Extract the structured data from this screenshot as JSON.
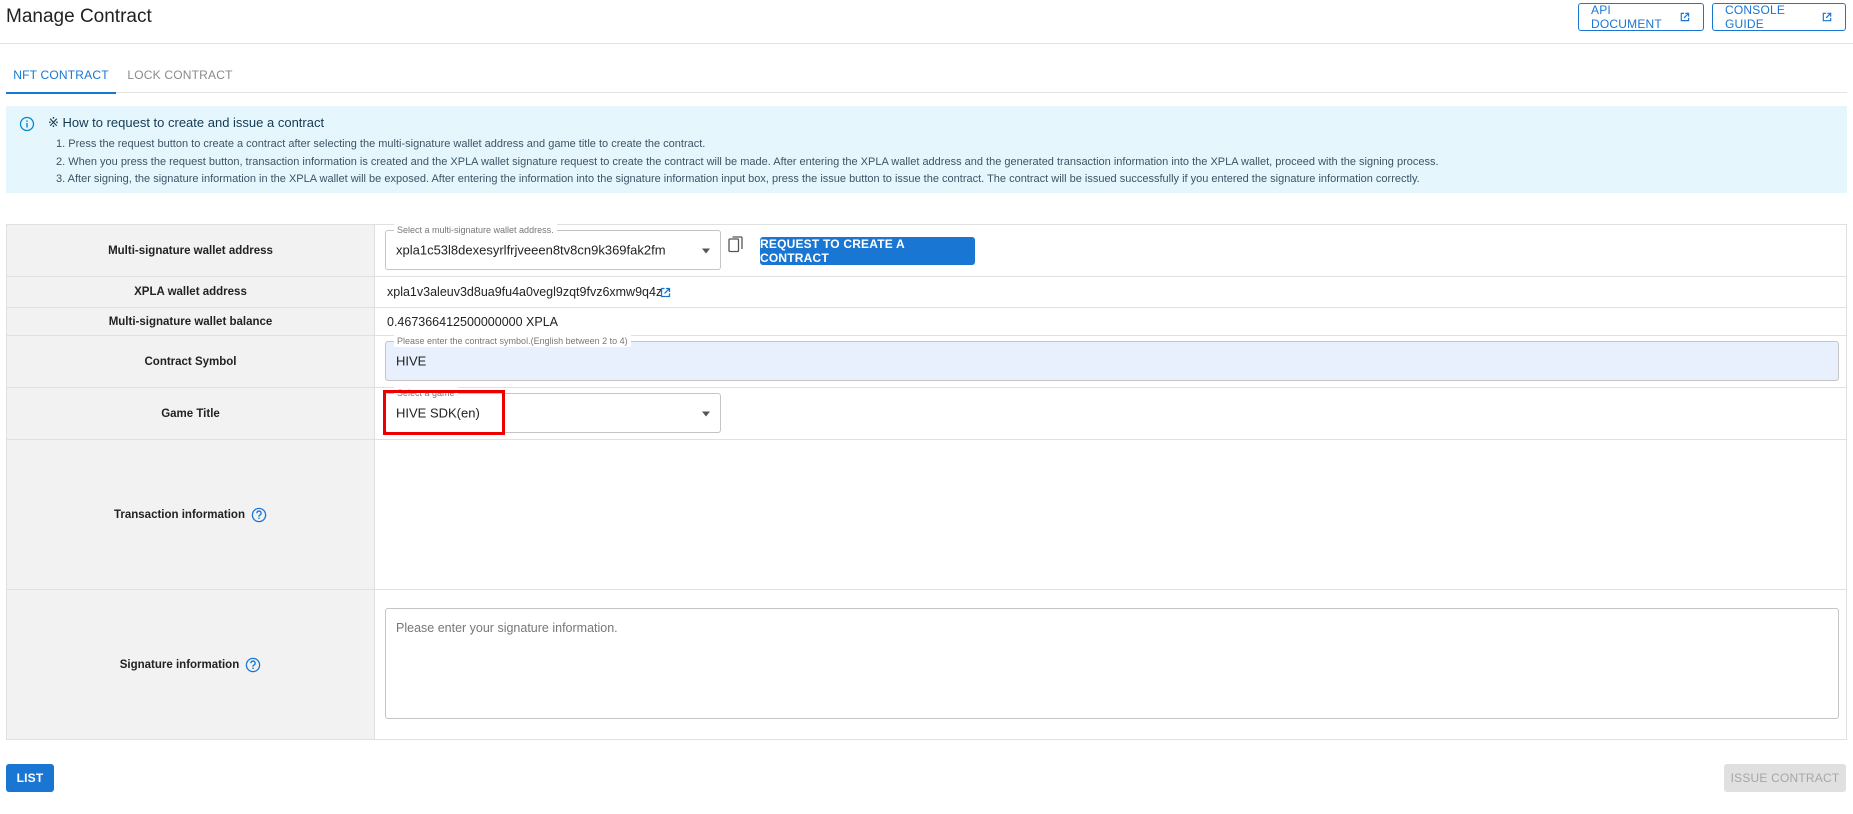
{
  "header": {
    "title": "Manage Contract",
    "api_document_label": "API DOCUMENT",
    "console_guide_label": "CONSOLE GUIDE"
  },
  "tabs": [
    {
      "label": "NFT CONTRACT",
      "active": true
    },
    {
      "label": "LOCK CONTRACT",
      "active": false
    }
  ],
  "info": {
    "title": "※ How to request to create and issue a contract",
    "lines": [
      "1. Press the request button to create a contract after selecting the multi-signature wallet address and game title to create the contract.",
      "2. When you press the request button, transaction information is created and the XPLA wallet signature request to create the contract will be made. After entering the XPLA wallet address and the generated transaction information into the XPLA wallet, proceed with the signing process.",
      "3. After signing, the signature information in the XPLA wallet will be exposed. After entering the information into the signature information input box, press the issue button to issue the contract. The contract will be issued successfully if you entered the signature information correctly."
    ]
  },
  "form": {
    "multisig": {
      "label": "Multi-signature wallet address",
      "legend": "Select a multi-signature wallet address.",
      "value": "xpla1c53l8dexesyrlfrjveeen8tv8cn9k369fak2fm",
      "request_button": "REQUEST TO CREATE A CONTRACT"
    },
    "xpla_address": {
      "label": "XPLA wallet address",
      "value": "xpla1v3aleuv3d8ua9fu4a0vegl9zqt9fvz6xmw9q4z"
    },
    "balance": {
      "label": "Multi-signature wallet balance",
      "value": "0.467366412500000000 XPLA"
    },
    "symbol": {
      "label": "Contract Symbol",
      "legend": "Please enter the contract symbol.(English between 2 to 4)",
      "value": "HIVE"
    },
    "game_title": {
      "label": "Game Title",
      "legend": "Select a game",
      "value": "HIVE SDK(en)"
    },
    "transaction": {
      "label": "Transaction information"
    },
    "signature": {
      "label": "Signature information",
      "placeholder": "Please enter your signature information."
    }
  },
  "footer": {
    "list_button": "LIST",
    "issue_button": "ISSUE CONTRACT"
  },
  "colors": {
    "primary": "#1976d2",
    "info_bg": "#e5f6fd",
    "highlight": "#ee0000",
    "symbol_field_bg": "#e8f0fe"
  }
}
